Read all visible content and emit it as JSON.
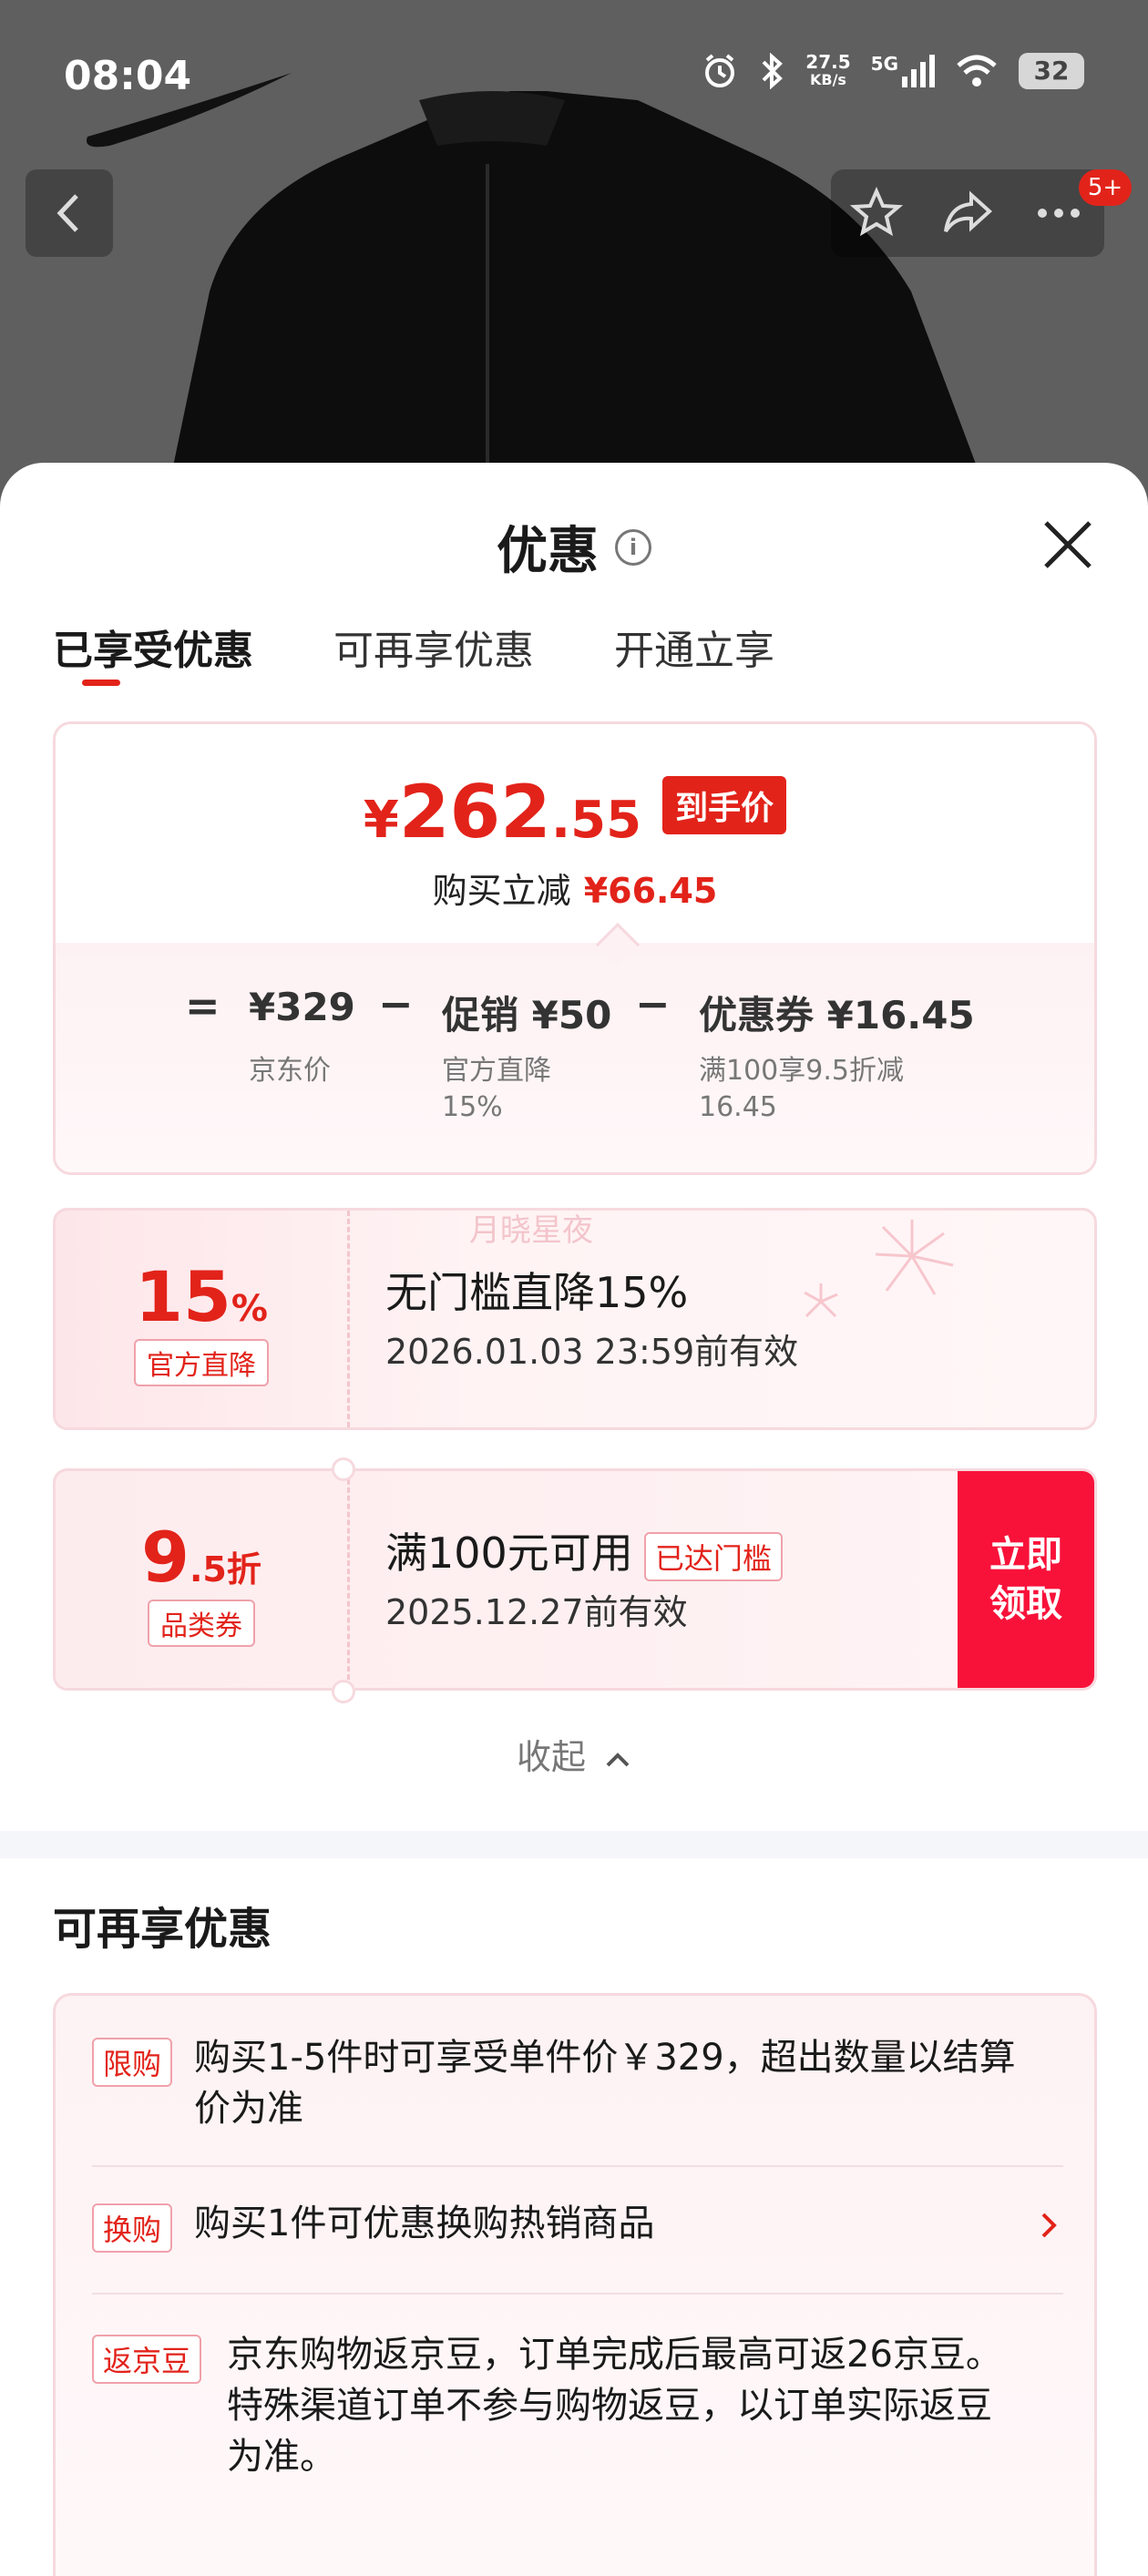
{
  "status_bar": {
    "time": "08:04",
    "net_speed_value": "27.5",
    "net_speed_unit": "KB/s",
    "network": "5G",
    "battery": "32"
  },
  "header": {
    "cart_badge": "5+"
  },
  "sheet": {
    "title": "优惠",
    "tabs": [
      "已享受优惠",
      "可再享优惠",
      "开通立享"
    ],
    "active_tab": 0
  },
  "summary": {
    "price_symbol": "¥",
    "price_int": "262",
    "price_dec": ".55",
    "price_tag": "到手价",
    "saving_label": "购买立减",
    "saving_amount": "¥66.45",
    "formula": {
      "eq": "=",
      "minus": "−",
      "base_value": "¥329",
      "base_label": "京东价",
      "promo_value": "促销 ¥50",
      "promo_label_1": "官方直降",
      "promo_label_2": "15%",
      "coupon_value": "优惠券 ¥16.45",
      "coupon_label_1": "满100享9.5折减",
      "coupon_label_2": "16.45"
    }
  },
  "coupon_discount": {
    "num": "15",
    "unit": "%",
    "tag": "官方直降",
    "title": "无门槛直降15%",
    "validity": "2026.01.03 23:59前有效",
    "watermark": "月晓星夜"
  },
  "coupon_category": {
    "num": "9",
    "unit": ".5折",
    "tag": "品类券",
    "title": "满100元可用",
    "threshold_tag": "已达门槛",
    "validity": "2025.12.27前有效",
    "claim_line1": "立即",
    "claim_line2": "领取"
  },
  "collapse_label": "收起",
  "more_offers": {
    "title": "可再享优惠",
    "items": [
      {
        "tag": "限购",
        "line1": "购买1-5件时可享受单件价￥329，超出数量以结算",
        "line2": "价为准"
      },
      {
        "tag": "换购",
        "line1": "购买1件可优惠换购热销商品"
      },
      {
        "tag": "返京豆",
        "line1": "京东购物返京豆，订单完成后最高可返26京豆。",
        "line2": "特殊渠道订单不参与购物返豆，以订单实际返豆",
        "line3": "为准。"
      }
    ]
  },
  "colors": {
    "accent": "#e2231a",
    "claim_button": "#f8123a",
    "card_border": "#f6d9de"
  }
}
